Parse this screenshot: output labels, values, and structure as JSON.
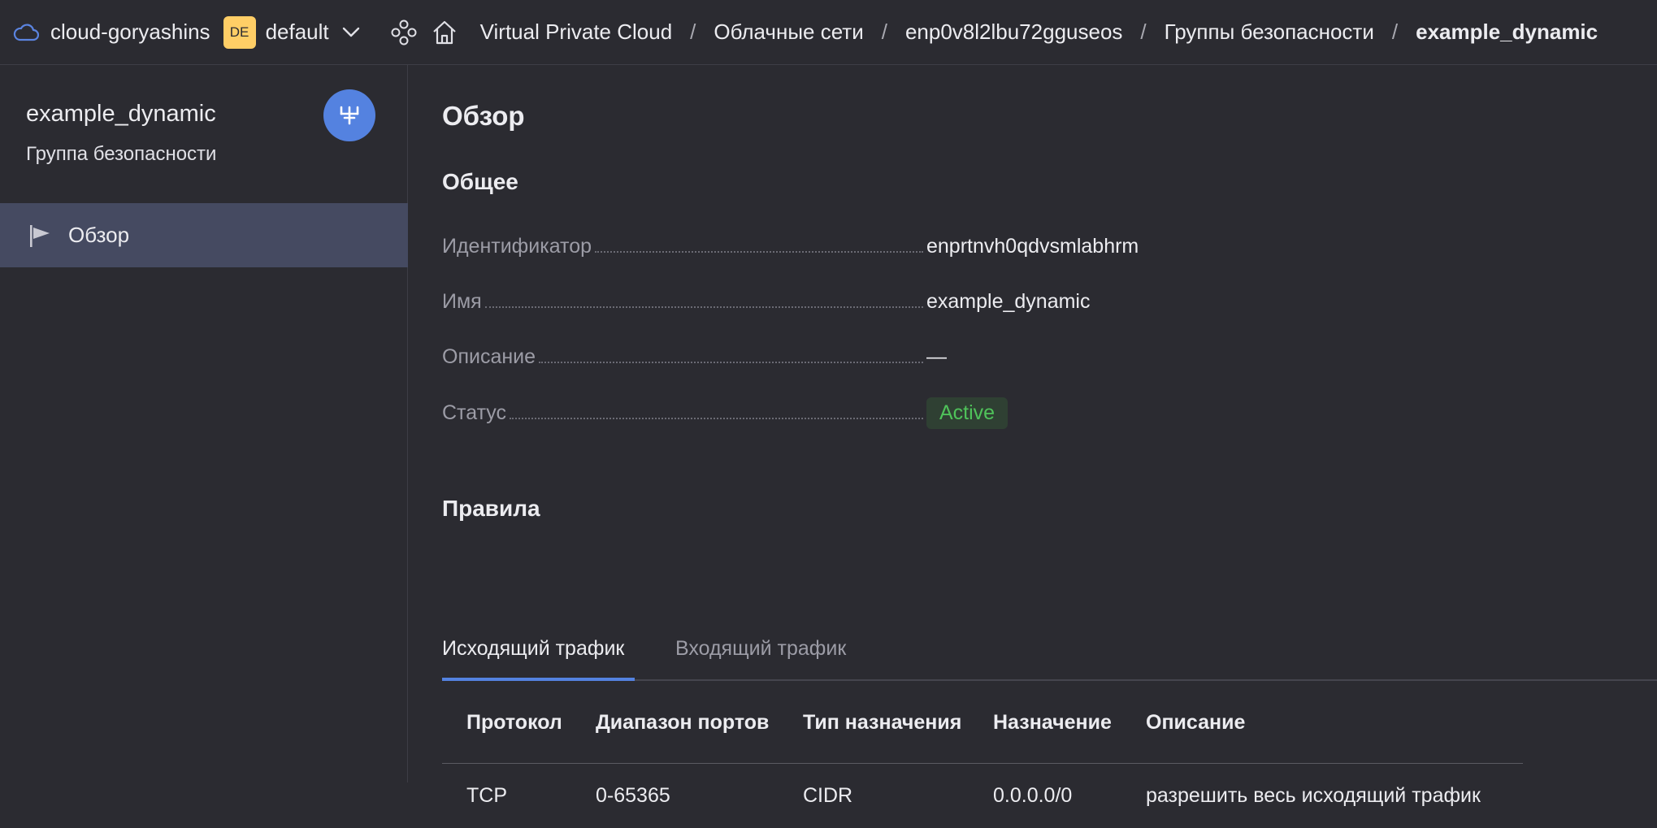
{
  "topbar": {
    "cloud_name": "cloud-goryashins",
    "folder_badge": "DE",
    "folder_name": "default",
    "icons": {
      "cloud": "cloud-icon",
      "chevron": "chevron-down-icon",
      "services": "services-icon",
      "home": "home-icon"
    }
  },
  "breadcrumbs": [
    "Virtual Private Cloud",
    "Облачные сети",
    "enp0v8l2lbu72gguseos",
    "Группы безопасности",
    "example_dynamic"
  ],
  "breadcrumb_separator": "/",
  "sidebar": {
    "title": "example_dynamic",
    "subtitle": "Группа безопасности",
    "resource_icon": "security-group-icon",
    "items": [
      {
        "label": "Обзор",
        "icon": "flag-icon",
        "active": true
      }
    ]
  },
  "main": {
    "page_title": "Обзор",
    "general_title": "Общее",
    "properties": [
      {
        "key": "Идентификатор",
        "value": "enprtnvh0qdvsmlabhrm"
      },
      {
        "key": "Имя",
        "value": "example_dynamic"
      },
      {
        "key": "Описание",
        "value": "—"
      },
      {
        "key": "Статус",
        "value": "Active"
      }
    ],
    "rules_title": "Правила",
    "tabs": [
      {
        "label": "Исходящий трафик",
        "active": true
      },
      {
        "label": "Входящий трафик",
        "active": false
      }
    ],
    "table": {
      "headers": [
        "Протокол",
        "Диапазон портов",
        "Тип назначения",
        "Назначение",
        "Описание"
      ],
      "rows": [
        [
          "TCP",
          "0-65365",
          "CIDR",
          "0.0.0.0/0",
          "разрешить весь исходящий трафик"
        ]
      ]
    }
  },
  "colors": {
    "background": "#2b2b31",
    "accent": "#5482e0",
    "active_nav": "#454a61",
    "folder_badge": "#ffce66",
    "status_active": "#4fc25a"
  }
}
